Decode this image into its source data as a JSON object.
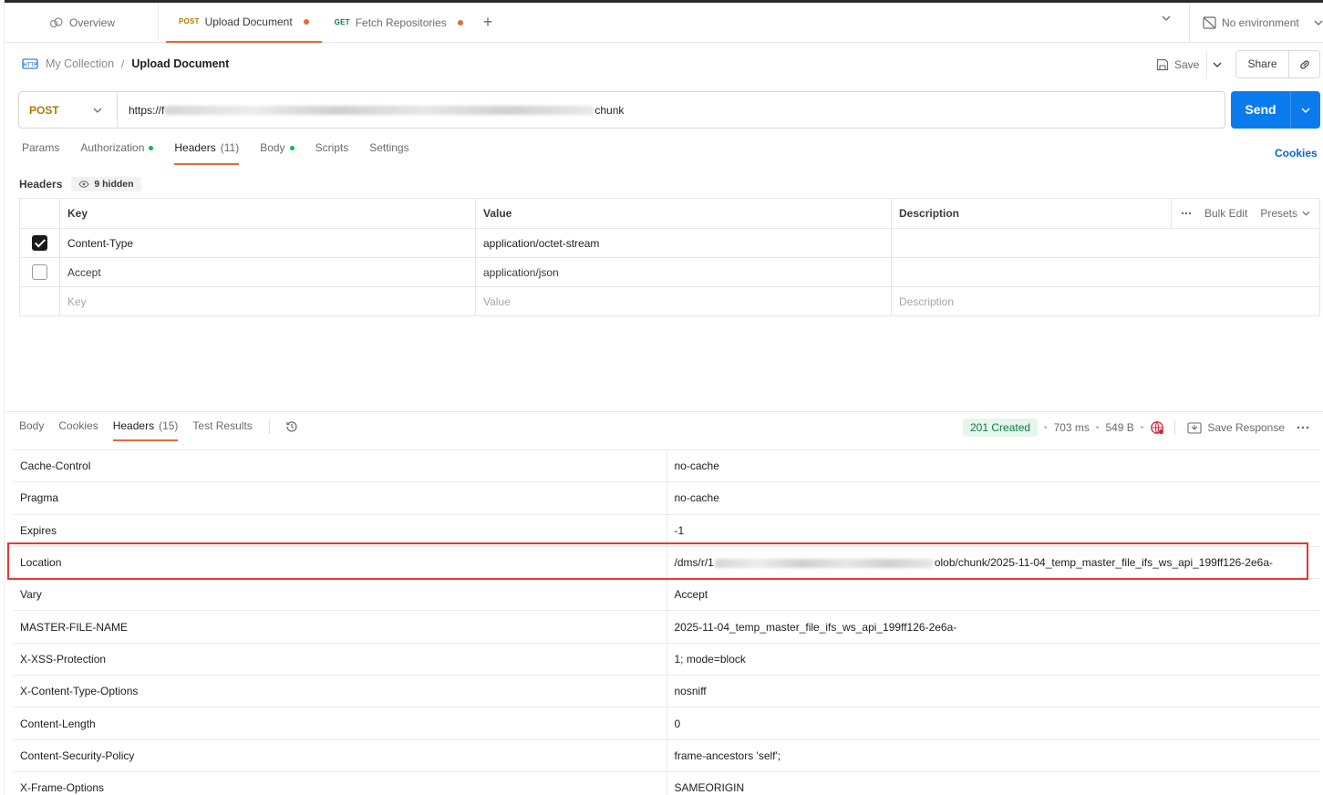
{
  "tabs": {
    "overview": "Overview",
    "items": [
      {
        "method": "POST",
        "label": "Upload Document",
        "active": true
      },
      {
        "method": "GET",
        "label": "Fetch Repositories",
        "active": false
      }
    ],
    "new_tab": "+",
    "environment": "No environment"
  },
  "breadcrumb": {
    "collection": "My Collection",
    "separator": "/",
    "current": "Upload Document"
  },
  "actions": {
    "save": "Save",
    "share": "Share"
  },
  "request": {
    "method": "POST",
    "url_prefix": "https://f",
    "url_suffix": "chunk",
    "send": "Send"
  },
  "request_tabs": {
    "params": "Params",
    "authorization": "Authorization",
    "headers": "Headers",
    "headers_count": "(11)",
    "body": "Body",
    "scripts": "Scripts",
    "settings": "Settings",
    "cookies": "Cookies"
  },
  "headers_section": {
    "title": "Headers",
    "hidden": "9 hidden",
    "col_key": "Key",
    "col_value": "Value",
    "col_description": "Description",
    "bulk_edit": "Bulk Edit",
    "presets": "Presets",
    "rows": [
      {
        "checked": true,
        "key": "Content-Type",
        "value": "application/octet-stream"
      },
      {
        "checked": false,
        "key": "Accept",
        "value": "application/json"
      }
    ],
    "placeholder": {
      "key": "Key",
      "value": "Value",
      "description": "Description"
    }
  },
  "response_tabs": {
    "body": "Body",
    "cookies": "Cookies",
    "headers": "Headers",
    "headers_count": "(15)",
    "test_results": "Test Results"
  },
  "response_status": {
    "status": "201 Created",
    "time": "703 ms",
    "size": "549 B",
    "save_response": "Save Response",
    "status_color": "#0b7a49"
  },
  "response_headers": [
    {
      "key": "Cache-Control",
      "value": "no-cache"
    },
    {
      "key": "Pragma",
      "value": "no-cache"
    },
    {
      "key": "Expires",
      "value": "-1"
    },
    {
      "key": "Location",
      "value_prefix": "/dms/r/1",
      "value_suffix": "olob/chunk/2025-11-04_temp_master_file_ifs_ws_api_199ff126-2e6a-"
    },
    {
      "key": "Vary",
      "value": "Accept"
    },
    {
      "key": "MASTER-FILE-NAME",
      "value": "2025-11-04_temp_master_file_ifs_ws_api_199ff126-2e6a-"
    },
    {
      "key": "X-XSS-Protection",
      "value": "1; mode=block"
    },
    {
      "key": "X-Content-Type-Options",
      "value": "nosniff"
    },
    {
      "key": "Content-Length",
      "value": "0"
    },
    {
      "key": "Content-Security-Policy",
      "value": "frame-ancestors 'self';"
    },
    {
      "key": "X-Frame-Options",
      "value": "SAMEORIGIN"
    }
  ]
}
